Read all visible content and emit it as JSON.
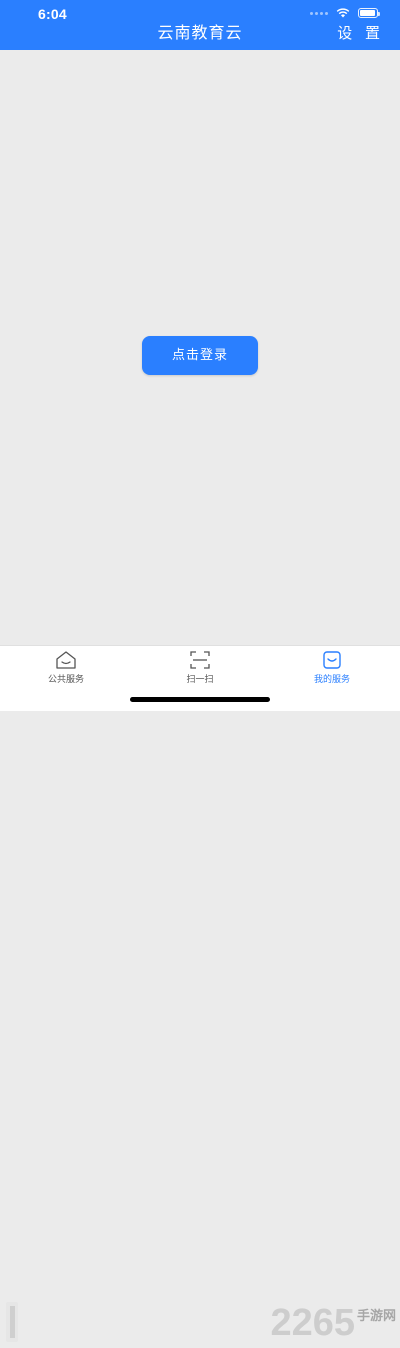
{
  "status_bar": {
    "time": "6:04",
    "icons": [
      "signal-dots-icon",
      "wifi-icon",
      "battery-icon"
    ]
  },
  "nav": {
    "title": "云南教育云",
    "settings_label": "设 置"
  },
  "main": {
    "login_button_label": "点击登录"
  },
  "tab_bar": {
    "tabs": [
      {
        "label": "公共服务",
        "icon": "home-icon",
        "active": false
      },
      {
        "label": "扫一扫",
        "icon": "scan-icon",
        "active": false
      },
      {
        "label": "我的服务",
        "icon": "my-service-icon",
        "active": true
      }
    ]
  },
  "watermark": {
    "number": "2265",
    "suffix": "手游网"
  },
  "colors": {
    "primary": "#2a7fff",
    "background": "#ebebeb",
    "tab_bar": "#ffffff"
  }
}
